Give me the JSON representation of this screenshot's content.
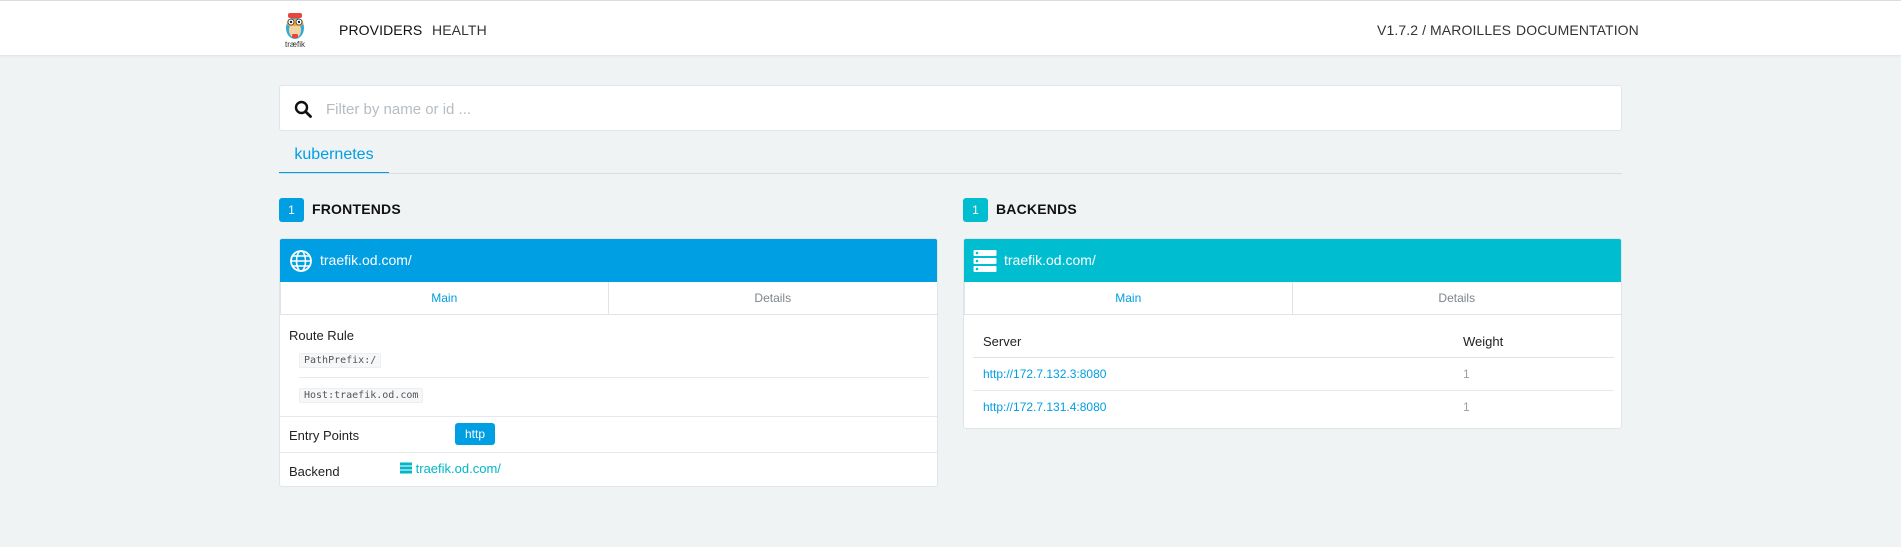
{
  "brand": {
    "logo_text": "træfik"
  },
  "nav": {
    "providers": "PROVIDERS",
    "health": "HEALTH",
    "version": "V1.7.2 / MAROILLES",
    "documentation": "DOCUMENTATION"
  },
  "search": {
    "placeholder": "Filter by name or id ...",
    "value": ""
  },
  "providers": {
    "tabs": [
      "kubernetes"
    ],
    "active_tab": "kubernetes"
  },
  "frontends": {
    "count": "1",
    "title": "FRONTENDS",
    "color": "#009ee3",
    "panel": {
      "name": "traefik.od.com/",
      "header_icon": "globe-icon",
      "tabs": {
        "main": "Main",
        "details": "Details"
      },
      "active_tab": "Main",
      "route_rule_label": "Route Rule",
      "route_rules": [
        "PathPrefix:/",
        "Host:traefik.od.com"
      ],
      "entry_points_label": "Entry Points",
      "entry_points": [
        "http"
      ],
      "backend_label": "Backend",
      "backend_value": "traefik.od.com/",
      "backend_icon": "server-stack-icon"
    }
  },
  "backends": {
    "count": "1",
    "title": "BACKENDS",
    "color": "#00bdd0",
    "panel": {
      "name": "traefik.od.com/",
      "header_icon": "server-stack-icon",
      "tabs": {
        "main": "Main",
        "details": "Details"
      },
      "active_tab": "Main",
      "columns": {
        "server": "Server",
        "weight": "Weight"
      },
      "servers": [
        {
          "url": "http://172.7.132.3:8080",
          "weight": "1"
        },
        {
          "url": "http://172.7.131.4:8080",
          "weight": "1"
        }
      ]
    }
  }
}
